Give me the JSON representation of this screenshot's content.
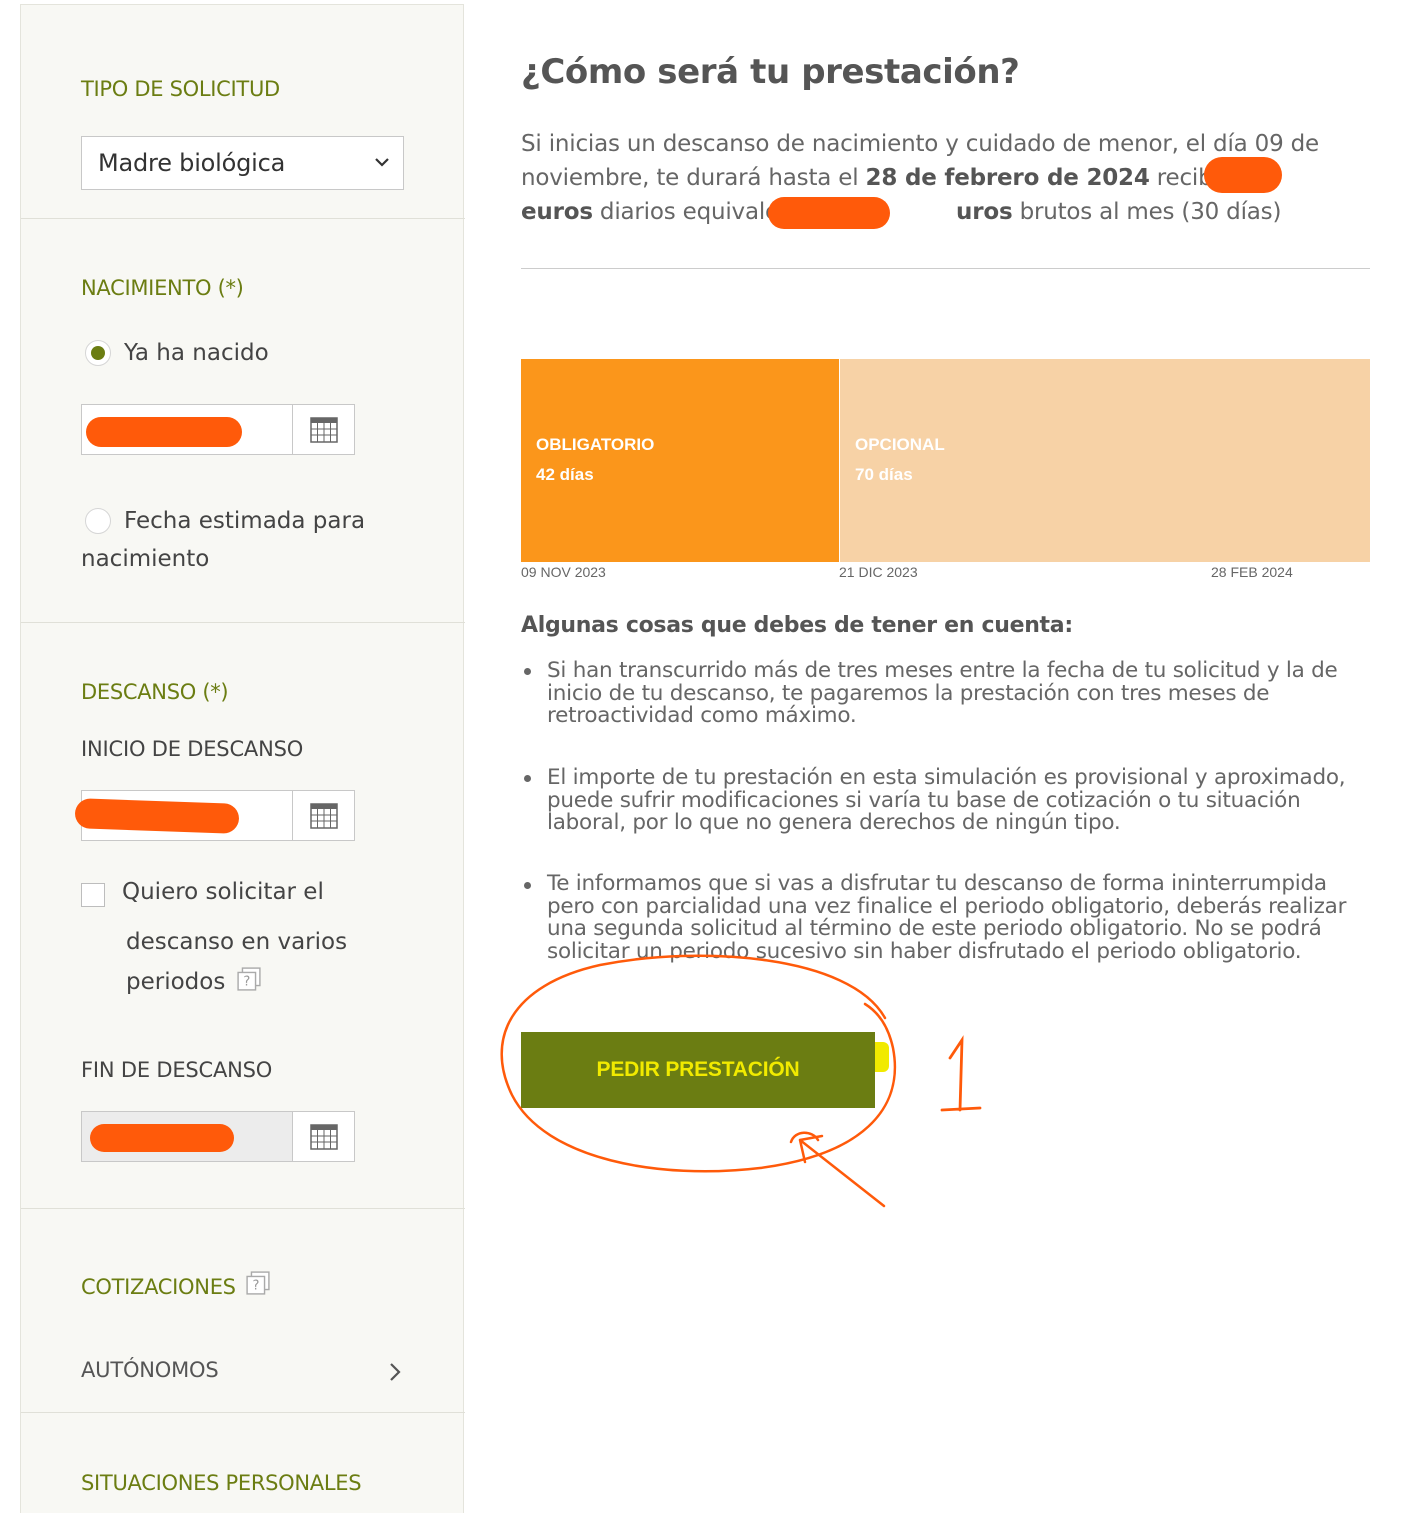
{
  "sidebar": {
    "tipo": {
      "title": "TIPO DE SOLICITUD",
      "selected": "Madre biológica"
    },
    "nacimiento": {
      "title": "NACIMIENTO (*)",
      "option_born": "Ya ha nacido",
      "option_estimated_line1": "Fecha estimada para",
      "option_estimated_line2": "nacimiento",
      "born_selected": true
    },
    "descanso": {
      "title": "DESCANSO (*)",
      "start_label": "INICIO DE DESCANSO",
      "multi_line1": "Quiero solicitar el",
      "multi_line2": "descanso en varios",
      "multi_line3": "periodos",
      "multi_checked": false,
      "end_label": "FIN DE DESCANSO"
    },
    "cotizaciones": {
      "title": "COTIZACIONES",
      "autonomos": "AUTÓNOMOS"
    },
    "situaciones": {
      "title": "SITUACIONES PERSONALES"
    }
  },
  "main": {
    "title": "¿Cómo será tu prestación?",
    "intro": {
      "p1": "Si inicias un descanso de nacimiento y cuidado de menor, el día 09 de noviembre, te durará hasta el ",
      "end_date": "28 de febrero de 2024",
      "p2": " recibirás ",
      "euros": "euros",
      "p3": " diarios equivalentes a ",
      "euros_partial": "uros",
      "p4": " brutos al mes (30 días)"
    },
    "timeline": {
      "mandatory_label": "OBLIGATORIO",
      "mandatory_days": "42 días",
      "optional_label": "OPCIONAL",
      "optional_days": "70 días",
      "mandatory_fraction": 0.375,
      "colors": {
        "mandatory": "#fb961b",
        "optional": "#f7d2a6"
      },
      "dates": [
        "09 NOV 2023",
        "21 DIC 2023",
        "28 FEB 2024"
      ]
    },
    "notes_title": "Algunas cosas que debes de tener en cuenta:",
    "notes": [
      [
        "Si han transcurrido más de tres meses entre la fecha de tu solicitud y la de",
        "inicio de tu descanso, te pagaremos la prestación con tres meses de",
        "retroactividad como máximo."
      ],
      [
        "El importe de tu prestación en esta simulación es provisional y aproximado,",
        "puede sufrir modificaciones si varía tu base de cotización o tu situación",
        "laboral, por lo que no genera derechos de ningún tipo."
      ],
      [
        "Te informamos que si vas a disfrutar tu descanso de forma ininterrumpida",
        "pero con parcialidad una vez finalice el periodo obligatorio, deberás realizar",
        "una segunda solicitud al término de este periodo obligatorio. No se podrá",
        "solicitar un periodo sucesivo sin haber disfrutado el periodo obligatorio."
      ]
    ],
    "cta": "PEDIR PRESTACIÓN",
    "annotation_number": "1",
    "accent_color": "#6b7d12"
  }
}
